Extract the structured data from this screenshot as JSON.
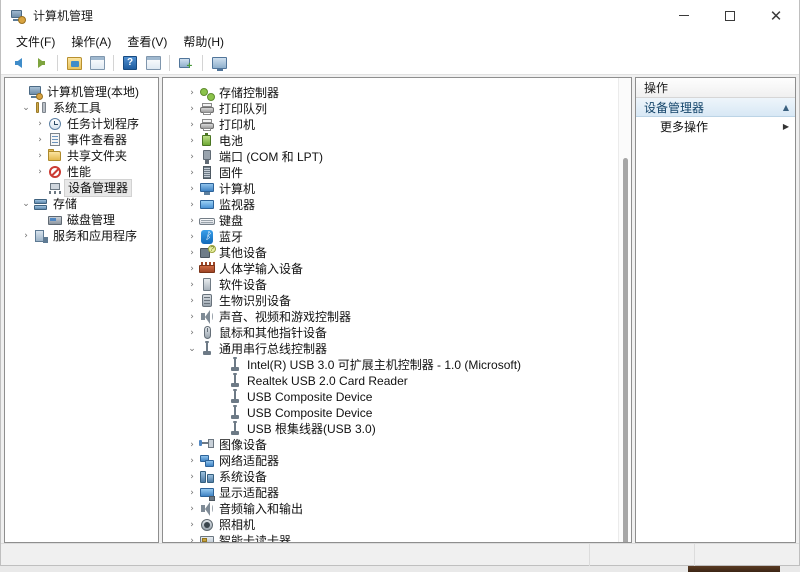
{
  "window": {
    "title": "计算机管理",
    "icon": "computer-management-icon",
    "minimize_label": "",
    "maximize_label": "",
    "close_label": "✕"
  },
  "menubar": {
    "items": [
      {
        "label": "文件(F)",
        "key": "F"
      },
      {
        "label": "操作(A)",
        "key": "A"
      },
      {
        "label": "查看(V)",
        "key": "V"
      },
      {
        "label": "帮助(H)",
        "key": "H"
      }
    ]
  },
  "toolbar": {
    "buttons": [
      {
        "name": "back-button",
        "icon": "arrow-left-icon",
        "label": "后退"
      },
      {
        "name": "forward-button",
        "icon": "arrow-right-icon",
        "label": "前进"
      },
      {
        "name": "up-folder-button",
        "icon": "folder-up-icon",
        "label": "上一级"
      },
      {
        "name": "show-hide-console-tree-button",
        "icon": "console-tree-icon",
        "label": "显示/隐藏控制台树"
      },
      {
        "name": "help-button",
        "icon": "help-question-icon",
        "label": "帮助"
      },
      {
        "name": "properties-button",
        "icon": "properties-window-icon",
        "label": "属性"
      },
      {
        "name": "scan-hardware-changes-button",
        "icon": "scan-hardware-icon",
        "label": "扫描检测硬件改动"
      },
      {
        "name": "device-view-button",
        "icon": "monitor-icon",
        "label": "设备视图"
      }
    ]
  },
  "console_tree": {
    "items": [
      {
        "label": "计算机管理(本地)",
        "icon": "computer-management-icon",
        "indent": 0,
        "expander": "none",
        "selected": false
      },
      {
        "label": "系统工具",
        "icon": "system-tools-icon",
        "indent": 1,
        "expander": "expanded",
        "selected": false
      },
      {
        "label": "任务计划程序",
        "icon": "task-scheduler-clock-icon",
        "indent": 2,
        "expander": "collapsed",
        "selected": false
      },
      {
        "label": "事件查看器",
        "icon": "event-viewer-icon",
        "indent": 2,
        "expander": "collapsed",
        "selected": false
      },
      {
        "label": "共享文件夹",
        "icon": "shared-folders-icon",
        "indent": 2,
        "expander": "collapsed",
        "selected": false
      },
      {
        "label": "性能",
        "icon": "performance-icon",
        "indent": 2,
        "expander": "collapsed",
        "selected": false
      },
      {
        "label": "设备管理器",
        "icon": "device-manager-icon",
        "indent": 2,
        "expander": "none",
        "selected": true
      },
      {
        "label": "存储",
        "icon": "storage-icon",
        "indent": 1,
        "expander": "expanded",
        "selected": false
      },
      {
        "label": "磁盘管理",
        "icon": "disk-management-icon",
        "indent": 2,
        "expander": "none",
        "selected": false
      },
      {
        "label": "服务和应用程序",
        "icon": "services-applications-icon",
        "indent": 1,
        "expander": "collapsed",
        "selected": false
      }
    ]
  },
  "device_tree": {
    "items": [
      {
        "label": "存储控制器",
        "icon": "storage-controller-icon",
        "indent": 1,
        "expander": "collapsed"
      },
      {
        "label": "打印队列",
        "icon": "print-queue-icon",
        "indent": 1,
        "expander": "collapsed"
      },
      {
        "label": "打印机",
        "icon": "printer-icon",
        "indent": 1,
        "expander": "collapsed"
      },
      {
        "label": "电池",
        "icon": "battery-icon",
        "indent": 1,
        "expander": "collapsed"
      },
      {
        "label": "端口 (COM 和 LPT)",
        "icon": "port-icon",
        "indent": 1,
        "expander": "collapsed"
      },
      {
        "label": "固件",
        "icon": "firmware-icon",
        "indent": 1,
        "expander": "collapsed"
      },
      {
        "label": "计算机",
        "icon": "computer-icon",
        "indent": 1,
        "expander": "collapsed"
      },
      {
        "label": "监视器",
        "icon": "monitor-icon",
        "indent": 1,
        "expander": "collapsed"
      },
      {
        "label": "键盘",
        "icon": "keyboard-icon",
        "indent": 1,
        "expander": "collapsed"
      },
      {
        "label": "蓝牙",
        "icon": "bluetooth-icon",
        "indent": 1,
        "expander": "collapsed"
      },
      {
        "label": "其他设备",
        "icon": "other-devices-icon",
        "indent": 1,
        "expander": "collapsed"
      },
      {
        "label": "人体学输入设备",
        "icon": "human-interface-device-icon",
        "indent": 1,
        "expander": "collapsed"
      },
      {
        "label": "软件设备",
        "icon": "software-device-icon",
        "indent": 1,
        "expander": "collapsed"
      },
      {
        "label": "生物识别设备",
        "icon": "biometric-device-icon",
        "indent": 1,
        "expander": "collapsed"
      },
      {
        "label": "声音、视频和游戏控制器",
        "icon": "sound-video-game-controller-icon",
        "indent": 1,
        "expander": "collapsed"
      },
      {
        "label": "鼠标和其他指针设备",
        "icon": "mouse-pointing-device-icon",
        "indent": 1,
        "expander": "collapsed"
      },
      {
        "label": "通用串行总线控制器",
        "icon": "usb-controller-icon",
        "indent": 1,
        "expander": "expanded"
      },
      {
        "label": "Intel(R) USB 3.0 可扩展主机控制器 - 1.0 (Microsoft)",
        "icon": "usb-device-icon",
        "indent": 2,
        "expander": "none"
      },
      {
        "label": "Realtek USB 2.0 Card Reader",
        "icon": "usb-device-icon",
        "indent": 2,
        "expander": "none"
      },
      {
        "label": "USB Composite Device",
        "icon": "usb-device-icon",
        "indent": 2,
        "expander": "none"
      },
      {
        "label": "USB Composite Device",
        "icon": "usb-device-icon",
        "indent": 2,
        "expander": "none"
      },
      {
        "label": "USB 根集线器(USB 3.0)",
        "icon": "usb-device-icon",
        "indent": 2,
        "expander": "none"
      },
      {
        "label": "图像设备",
        "icon": "imaging-device-icon",
        "indent": 1,
        "expander": "collapsed"
      },
      {
        "label": "网络适配器",
        "icon": "network-adapter-icon",
        "indent": 1,
        "expander": "collapsed"
      },
      {
        "label": "系统设备",
        "icon": "system-device-icon",
        "indent": 1,
        "expander": "collapsed"
      },
      {
        "label": "显示适配器",
        "icon": "display-adapter-icon",
        "indent": 1,
        "expander": "collapsed"
      },
      {
        "label": "音频输入和输出",
        "icon": "audio-input-output-icon",
        "indent": 1,
        "expander": "collapsed"
      },
      {
        "label": "照相机",
        "icon": "camera-icon",
        "indent": 1,
        "expander": "collapsed"
      },
      {
        "label": "智能卡读卡器",
        "icon": "smart-card-reader-icon",
        "indent": 1,
        "expander": "collapsed"
      }
    ]
  },
  "actions": {
    "header": "操作",
    "section_title": "设备管理器",
    "section_caret": "▲",
    "items": [
      {
        "label": "更多操作",
        "submenu_arrow": "▶"
      }
    ]
  },
  "statusbar": {
    "message": "",
    "cell2": "",
    "cell3": ""
  },
  "colors": {
    "accent_blue": "#3f83c4",
    "section_blue": "#d8e8f5",
    "selection_gray": "#e8e8e8",
    "window_border": "#bfbfbf"
  }
}
